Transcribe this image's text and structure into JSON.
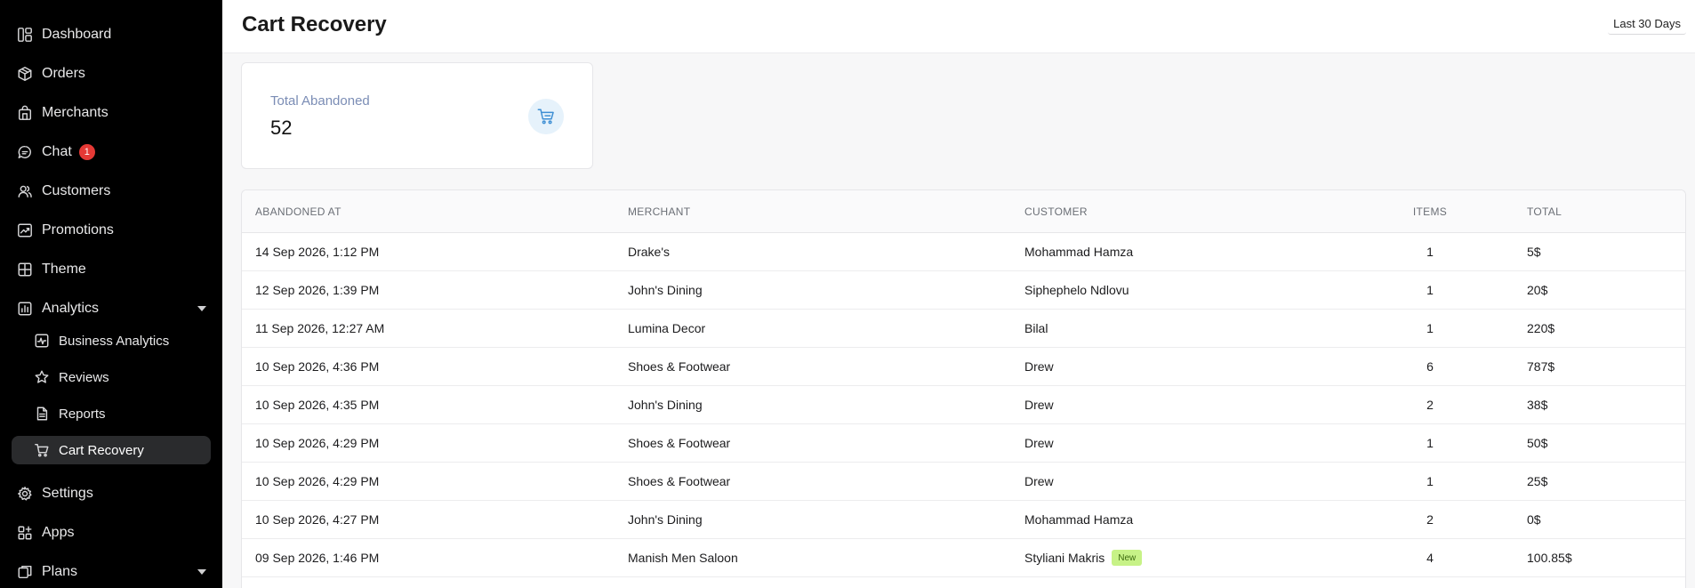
{
  "sidebar": {
    "items": [
      {
        "label": "Dashboard",
        "icon": "dashboard-icon"
      },
      {
        "label": "Orders",
        "icon": "box-icon"
      },
      {
        "label": "Merchants",
        "icon": "store-icon"
      },
      {
        "label": "Chat",
        "icon": "chat-icon",
        "badge": "1"
      },
      {
        "label": "Customers",
        "icon": "users-icon"
      },
      {
        "label": "Promotions",
        "icon": "trend-icon"
      },
      {
        "label": "Theme",
        "icon": "grid-icon"
      },
      {
        "label": "Analytics",
        "icon": "bar-chart-icon"
      }
    ],
    "analytics_sub": [
      {
        "label": "Business Analytics",
        "icon": "analytics-pulse-icon"
      },
      {
        "label": "Reviews",
        "icon": "star-icon"
      },
      {
        "label": "Reports",
        "icon": "document-icon"
      },
      {
        "label": "Cart Recovery",
        "icon": "cart-icon",
        "active": true
      }
    ],
    "bottom": [
      {
        "label": "Settings",
        "icon": "gear-icon"
      },
      {
        "label": "Apps",
        "icon": "apps-icon"
      },
      {
        "label": "Plans",
        "icon": "layers-icon"
      }
    ]
  },
  "header": {
    "title": "Cart Recovery",
    "range": "Last 30 Days"
  },
  "stat": {
    "label": "Total Abandoned",
    "value": "52",
    "icon": "cart-icon",
    "icon_color": "#3e8fd4"
  },
  "table": {
    "columns": [
      "ABANDONED AT",
      "MERCHANT",
      "CUSTOMER",
      "ITEMS",
      "TOTAL"
    ],
    "rows": [
      {
        "at": "14 Sep 2026, 1:12 PM",
        "merchant": "Drake's",
        "customer": "Mohammad Hamza",
        "items": "1",
        "total": "5$"
      },
      {
        "at": "12 Sep 2026, 1:39 PM",
        "merchant": "John's Dining",
        "customer": "Siphephelo Ndlovu",
        "items": "1",
        "total": "20$"
      },
      {
        "at": "11 Sep 2026, 12:27 AM",
        "merchant": "Lumina Decor",
        "customer": "Bilal",
        "items": "1",
        "total": "220$"
      },
      {
        "at": "10 Sep 2026, 4:36 PM",
        "merchant": "Shoes & Footwear",
        "customer": "Drew",
        "items": "6",
        "total": "787$"
      },
      {
        "at": "10 Sep 2026, 4:35 PM",
        "merchant": "John's Dining",
        "customer": "Drew",
        "items": "2",
        "total": "38$"
      },
      {
        "at": "10 Sep 2026, 4:29 PM",
        "merchant": "Shoes & Footwear",
        "customer": "Drew",
        "items": "1",
        "total": "50$"
      },
      {
        "at": "10 Sep 2026, 4:29 PM",
        "merchant": "Shoes & Footwear",
        "customer": "Drew",
        "items": "1",
        "total": "25$"
      },
      {
        "at": "10 Sep 2026, 4:27 PM",
        "merchant": "John's Dining",
        "customer": "Mohammad Hamza",
        "items": "2",
        "total": "0$"
      },
      {
        "at": "09 Sep 2026, 1:46 PM",
        "merchant": "Manish Men Saloon",
        "customer": "Styliani Makris",
        "customer_tag": "New",
        "items": "4",
        "total": "100.85$"
      }
    ]
  },
  "colors": {
    "sidebar_bg": "#000000",
    "accent": "#3e8fd4",
    "badge": "#e53935",
    "new_tag": "#c7f287"
  }
}
